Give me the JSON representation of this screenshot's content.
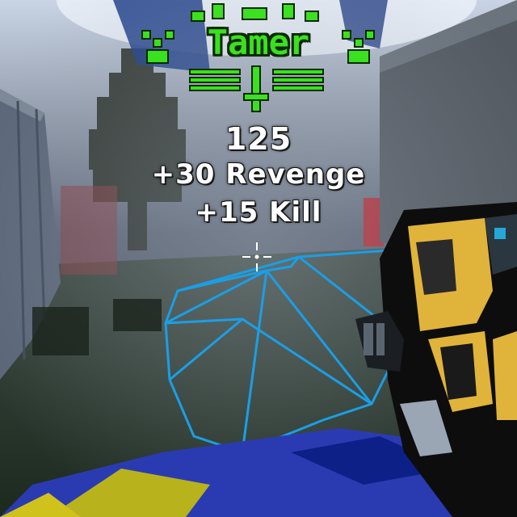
{
  "hud": {
    "badge": {
      "title": "Tamer",
      "color": "#3be01f"
    },
    "score": "125",
    "bonuses": [
      "+30 Revenge",
      "+15 Kill"
    ]
  },
  "icons": [
    "crosshair-icon",
    "sword-icon",
    "paw-icon"
  ]
}
